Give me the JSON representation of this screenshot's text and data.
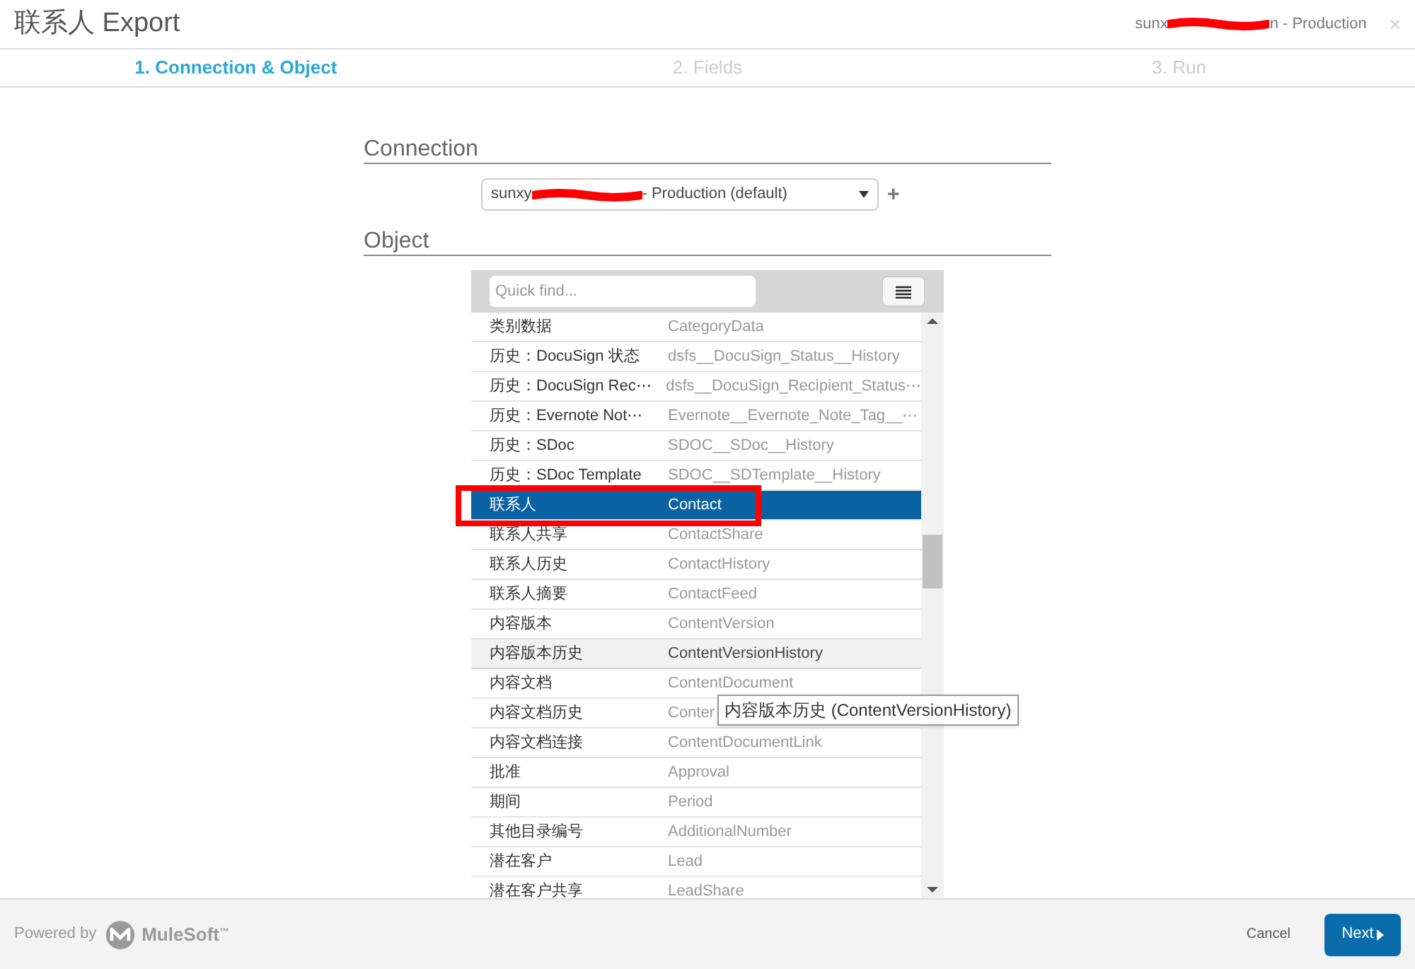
{
  "window": {
    "title": "联系人 Export",
    "account_prefix": "sunx",
    "account_suffix": "n - Production",
    "close": "×"
  },
  "steps": [
    {
      "label": "1. Connection & Object",
      "selected": true
    },
    {
      "label": "2. Fields",
      "selected": false
    },
    {
      "label": "3. Run",
      "selected": false
    }
  ],
  "connection": {
    "heading": "Connection",
    "value_prefix": "sunxy",
    "value_suffix": "- Production (default)",
    "add": "+"
  },
  "object": {
    "heading": "Object",
    "search": {
      "placeholder": "Quick find..."
    },
    "rows": [
      {
        "label": "类别数据",
        "api_name": "CategoryData",
        "selected": false,
        "hovered": false
      },
      {
        "label": "历史：DocuSign 状态",
        "api_name": "dsfs__DocuSign_Status__History",
        "selected": false,
        "hovered": false
      },
      {
        "label": "历史：DocuSign Rec⋯",
        "api_name": "dsfs__DocuSign_Recipient_Status⋯",
        "selected": false,
        "hovered": false
      },
      {
        "label": "历史：Evernote Not⋯",
        "api_name": "Evernote__Evernote_Note_Tag__⋯",
        "selected": false,
        "hovered": false
      },
      {
        "label": "历史：SDoc",
        "api_name": "SDOC__SDoc__History",
        "selected": false,
        "hovered": false
      },
      {
        "label": "历史：SDoc Template",
        "api_name": "SDOC__SDTemplate__History",
        "selected": false,
        "hovered": false
      },
      {
        "label": "联系人",
        "api_name": "Contact",
        "selected": true,
        "hovered": false
      },
      {
        "label": "联系人共享",
        "api_name": "ContactShare",
        "selected": false,
        "hovered": false
      },
      {
        "label": "联系人历史",
        "api_name": "ContactHistory",
        "selected": false,
        "hovered": false
      },
      {
        "label": "联系人摘要",
        "api_name": "ContactFeed",
        "selected": false,
        "hovered": false
      },
      {
        "label": "内容版本",
        "api_name": "ContentVersion",
        "selected": false,
        "hovered": false
      },
      {
        "label": "内容版本历史",
        "api_name": "ContentVersionHistory",
        "selected": false,
        "hovered": true
      },
      {
        "label": "内容文档",
        "api_name": "ContentDocument",
        "selected": false,
        "hovered": false
      },
      {
        "label": "内容文档历史",
        "api_name": "Conter",
        "selected": false,
        "hovered": false
      },
      {
        "label": "内容文档连接",
        "api_name": "ContentDocumentLink",
        "selected": false,
        "hovered": false
      },
      {
        "label": "批准",
        "api_name": "Approval",
        "selected": false,
        "hovered": false
      },
      {
        "label": "期间",
        "api_name": "Period",
        "selected": false,
        "hovered": false
      },
      {
        "label": "其他目录编号",
        "api_name": "AdditionalNumber",
        "selected": false,
        "hovered": false
      },
      {
        "label": "潜在客户",
        "api_name": "Lead",
        "selected": false,
        "hovered": false
      },
      {
        "label": "潜在客户共享",
        "api_name": "LeadShare",
        "selected": false,
        "hovered": false
      }
    ],
    "tooltip": "内容版本历史 (ContentVersionHistory)"
  },
  "footer": {
    "powered_by": "Powered by",
    "brand": "MuleSoft",
    "trademark": "™",
    "cancel": "Cancel",
    "next": "Next"
  }
}
